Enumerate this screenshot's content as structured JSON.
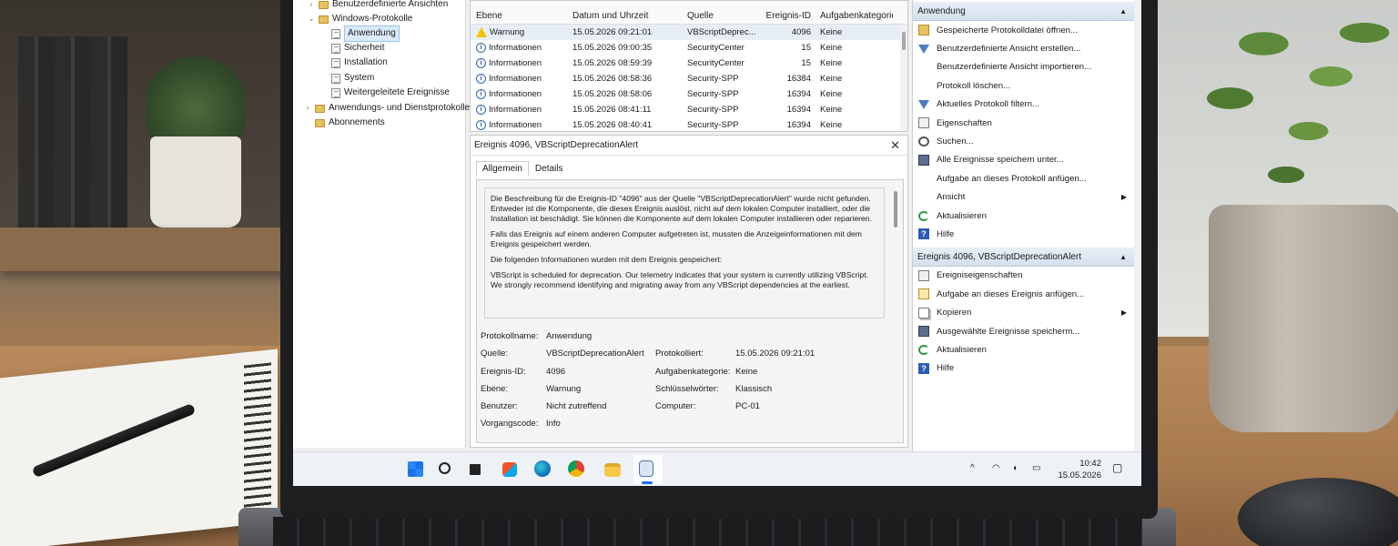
{
  "tree": {
    "items": [
      {
        "label": "Benutzerdefinierte Ansichten",
        "arrow": "›"
      },
      {
        "label": "Windows-Protokolle",
        "arrow": "⌄"
      },
      {
        "label": "Anwendung"
      },
      {
        "label": "Sicherheit"
      },
      {
        "label": "Installation"
      },
      {
        "label": "System"
      },
      {
        "label": "Weitergeleitete Ereignisse"
      },
      {
        "label": "Anwendungs- und Dienstprotokolle",
        "arrow": "›"
      },
      {
        "label": "Abonnements"
      }
    ]
  },
  "events": {
    "columns": [
      "Ebene",
      "Datum und Uhrzeit",
      "Quelle",
      "Ereignis-ID",
      "Aufgabenkategorie"
    ],
    "rows": [
      {
        "level": "Warnung",
        "date": "15.05.2026 09:21:01",
        "source": "VBScriptDeprec...",
        "id": "4096",
        "task": "Keine",
        "icon": "warning-icon"
      },
      {
        "level": "Informationen",
        "date": "15.05.2026 09:00:35",
        "source": "SecurityCenter",
        "id": "15",
        "task": "Keine",
        "icon": "info-icon"
      },
      {
        "level": "Informationen",
        "date": "15.05.2026 08:59:39",
        "source": "SecurityCenter",
        "id": "15",
        "task": "Keine",
        "icon": "info-icon"
      },
      {
        "level": "Informationen",
        "date": "15.05.2026 08:58:36",
        "source": "Security-SPP",
        "id": "16384",
        "task": "Keine",
        "icon": "info-icon"
      },
      {
        "level": "Informationen",
        "date": "15.05.2026 08:58:06",
        "source": "Security-SPP",
        "id": "16394",
        "task": "Keine",
        "icon": "info-icon"
      },
      {
        "level": "Informationen",
        "date": "15.05.2026 08:41:11",
        "source": "Security-SPP",
        "id": "16394",
        "task": "Keine",
        "icon": "info-icon"
      },
      {
        "level": "Informationen",
        "date": "15.05.2026 08:40:41",
        "source": "Security-SPP",
        "id": "16394",
        "task": "Keine",
        "icon": "info-icon"
      }
    ]
  },
  "detail": {
    "title": "Ereignis 4096, VBScriptDeprecationAlert",
    "tabs": [
      "Allgemein",
      "Details"
    ],
    "desc": [
      "Die Beschreibung für die Ereignis-ID \"4096\" aus der Quelle \"VBScriptDeprecationAlert\" wurde nicht gefunden. Entweder ist die Komponente, die dieses Ereignis auslöst, nicht auf dem lokalen Computer installiert, oder die Installation ist beschädigt. Sie können die Komponente auf dem lokalen Computer installieren oder reparieren.",
      "Falls das Ereignis auf einem anderen Computer aufgetreten ist, mussten die Anzeigeinformationen mit dem Ereignis gespeichert werden.",
      "Die folgenden Informationen wurden mit dem Ereignis gespeichert:",
      "VBScript is scheduled for deprecation. Our telemetry indicates that your system is currently utilizing VBScript. We strongly recommend identifying and migrating away from any VBScript dependencies at the earliest."
    ],
    "fields": {
      "log_label": "Protokollname:",
      "log_value": "Anwendung",
      "source_label": "Quelle:",
      "source_value": "VBScriptDeprecationAlert",
      "logged_label": "Protokolliert:",
      "logged_value": "15.05.2026 09:21:01",
      "id_label": "Ereignis-ID:",
      "id_value": "4096",
      "task_label": "Aufgabenkategorie:",
      "task_value": "Keine",
      "level_label": "Ebene:",
      "level_value": "Warnung",
      "keywords_label": "Schlüsselwörter:",
      "keywords_value": "Klassisch",
      "user_label": "Benutzer:",
      "user_value": "Nicht zutreffend",
      "computer_label": "Computer:",
      "computer_value": "PC-01",
      "opcode_label": "Vorgangscode:",
      "opcode_value": "Info"
    }
  },
  "actions": {
    "section1_title": "Anwendung",
    "section1": [
      {
        "label": "Gespeicherte Protokolldatei öffnen...",
        "icon": "open-log-icon"
      },
      {
        "label": "Benutzerdefinierte Ansicht erstellen...",
        "icon": "filter-icon"
      },
      {
        "label": "Benutzerdefinierte Ansicht importieren...",
        "icon": ""
      },
      {
        "label": "Protokoll löschen...",
        "icon": ""
      },
      {
        "label": "Aktuelles Protokoll filtern...",
        "icon": "filter-icon"
      },
      {
        "label": "Eigenschaften",
        "icon": "properties-icon"
      },
      {
        "label": "Suchen...",
        "icon": "find-icon"
      },
      {
        "label": "Alle Ereignisse speichern unter...",
        "icon": "save-icon"
      },
      {
        "label": "Aufgabe an dieses Protokoll anfügen...",
        "icon": ""
      },
      {
        "label": "Ansicht",
        "icon": "",
        "submenu": true
      },
      {
        "label": "Aktualisieren",
        "icon": "refresh-icon"
      },
      {
        "label": "Hilfe",
        "icon": "help-icon"
      }
    ],
    "section2_title": "Ereignis 4096, VBScriptDeprecationAlert",
    "section2": [
      {
        "label": "Ereigniseigenschaften",
        "icon": "properties-icon"
      },
      {
        "label": "Aufgabe an dieses Ereignis anfügen...",
        "icon": "task-icon"
      },
      {
        "label": "Kopieren",
        "icon": "copy-icon",
        "submenu": true
      },
      {
        "label": "Ausgewählte Ereignisse speicherm...",
        "icon": "save-icon"
      },
      {
        "label": "Aktualisieren",
        "icon": "refresh-icon"
      },
      {
        "label": "Hilfe",
        "icon": "help-icon"
      }
    ]
  },
  "taskbar": {
    "time": "10:42",
    "date": "15.05.2026",
    "tray": [
      "^",
      "wifi-icon",
      "speaker-icon",
      "battery-icon"
    ]
  }
}
